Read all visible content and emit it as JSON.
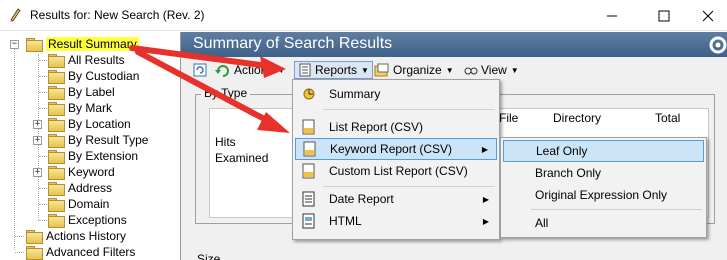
{
  "window": {
    "title": "Results for:  New Search (Rev.  2)",
    "title_icon": "pencil-icon",
    "controls": [
      "minimize-icon",
      "maximize-icon",
      "close-icon"
    ]
  },
  "tree": {
    "items": [
      {
        "label": "Result Summary",
        "selected": true
      },
      {
        "label": "All Results"
      },
      {
        "label": "By Custodian"
      },
      {
        "label": "By Label"
      },
      {
        "label": "By Mark"
      },
      {
        "label": "By Location"
      },
      {
        "label": "By Result Type"
      },
      {
        "label": "By Extension"
      },
      {
        "label": "Keyword"
      },
      {
        "label": "Address"
      },
      {
        "label": "Domain"
      },
      {
        "label": "Exceptions"
      },
      {
        "label": "Actions History"
      },
      {
        "label": "Advanced Filters"
      }
    ]
  },
  "panel": {
    "title": "Summary of Search Results",
    "toolbar": {
      "actions": "Actions",
      "reports": "Reports",
      "organize": "Organize",
      "view": "View"
    },
    "groupbox": {
      "legend": "By Type",
      "columns": [
        "File",
        "Directory",
        "Total"
      ],
      "rows": [
        "Hits",
        "Examined"
      ],
      "size_legend": "Size"
    }
  },
  "reports_menu": {
    "items": [
      {
        "label": "Summary",
        "icon": "summary-icon"
      },
      {
        "label": "List Report (CSV)",
        "icon": "csv-icon"
      },
      {
        "label": "Keyword Report (CSV)",
        "icon": "csv-icon",
        "submenu": true,
        "highlighted": true
      },
      {
        "label": "Custom List Report (CSV)",
        "icon": "csv-icon"
      },
      {
        "label": "Date  Report",
        "icon": "report-icon",
        "submenu": true
      },
      {
        "label": "HTML",
        "icon": "html-icon",
        "submenu": true
      }
    ]
  },
  "keyword_submenu": {
    "items": [
      {
        "label": "Leaf Only",
        "highlighted": true
      },
      {
        "label": "Branch Only"
      },
      {
        "label": "Original Expression Only"
      },
      {
        "label": "All"
      }
    ]
  },
  "colors": {
    "arrow": "#e8312a",
    "header_blue": "#3e6189",
    "selection_yellow": "#ffff3c",
    "menu_highlight": "#cce4f7"
  }
}
